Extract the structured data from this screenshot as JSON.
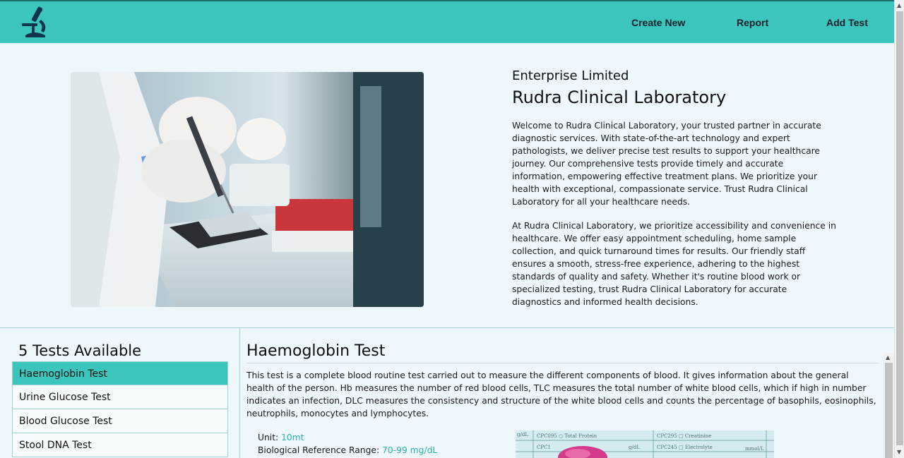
{
  "nav": {
    "logo_icon": "microscope-icon",
    "links": [
      "Create New",
      "Report",
      "Add Test"
    ]
  },
  "hero": {
    "subtitle": "Enterprise Limited",
    "title": "Rudra Clinical Laboratory",
    "paragraphs": [
      "Welcome to Rudra Clinical Laboratory, your trusted partner in accurate diagnostic services. With state-of-the-art technology and expert pathologists, we deliver precise test results to support your healthcare journey. Our comprehensive tests provide timely and accurate information, empowering effective treatment plans. We prioritize your health with exceptional, compassionate service. Trust Rudra Clinical Laboratory for all your healthcare needs.",
      "At Rudra Clinical Laboratory, we prioritize accessibility and convenience in healthcare. We offer easy appointment scheduling, home sample collection, and quick turnaround times for results. Our friendly staff ensures a smooth, stress-free experience, adhering to the highest standards of quality and safety. Whether it's routine blood work or specialized testing, trust Rudra Clinical Laboratory for accurate diagnostics and informed health decisions."
    ]
  },
  "tests": {
    "heading": "5 Tests Available",
    "items": [
      "Haemoglobin Test",
      "Urine Glucose Test",
      "Blood Glucose Test",
      "Stool DNA Test"
    ],
    "active_index": 0
  },
  "detail": {
    "title": "Haemoglobin Test",
    "description": "This test is a complete blood routine test carried out to measure the different components of blood. It gives information about the general health of the person. Hb measures the number of red blood cells, TLC measures the total number of white blood cells, which if high in number indicates an infection, DLC measures the consistency and structure of the white blood cells and counts the percentage of basophils, eosinophils, neutrophils, monocytes and lymphocytes.",
    "unit_label": "Unit:",
    "unit_value": "10mt",
    "range_label": "Biological Reference Range:",
    "range_value": "70-99 mg/dL"
  },
  "colors": {
    "accent": "#3bc5bd",
    "value_text": "#2eb3ab",
    "background": "#eef7fc"
  }
}
